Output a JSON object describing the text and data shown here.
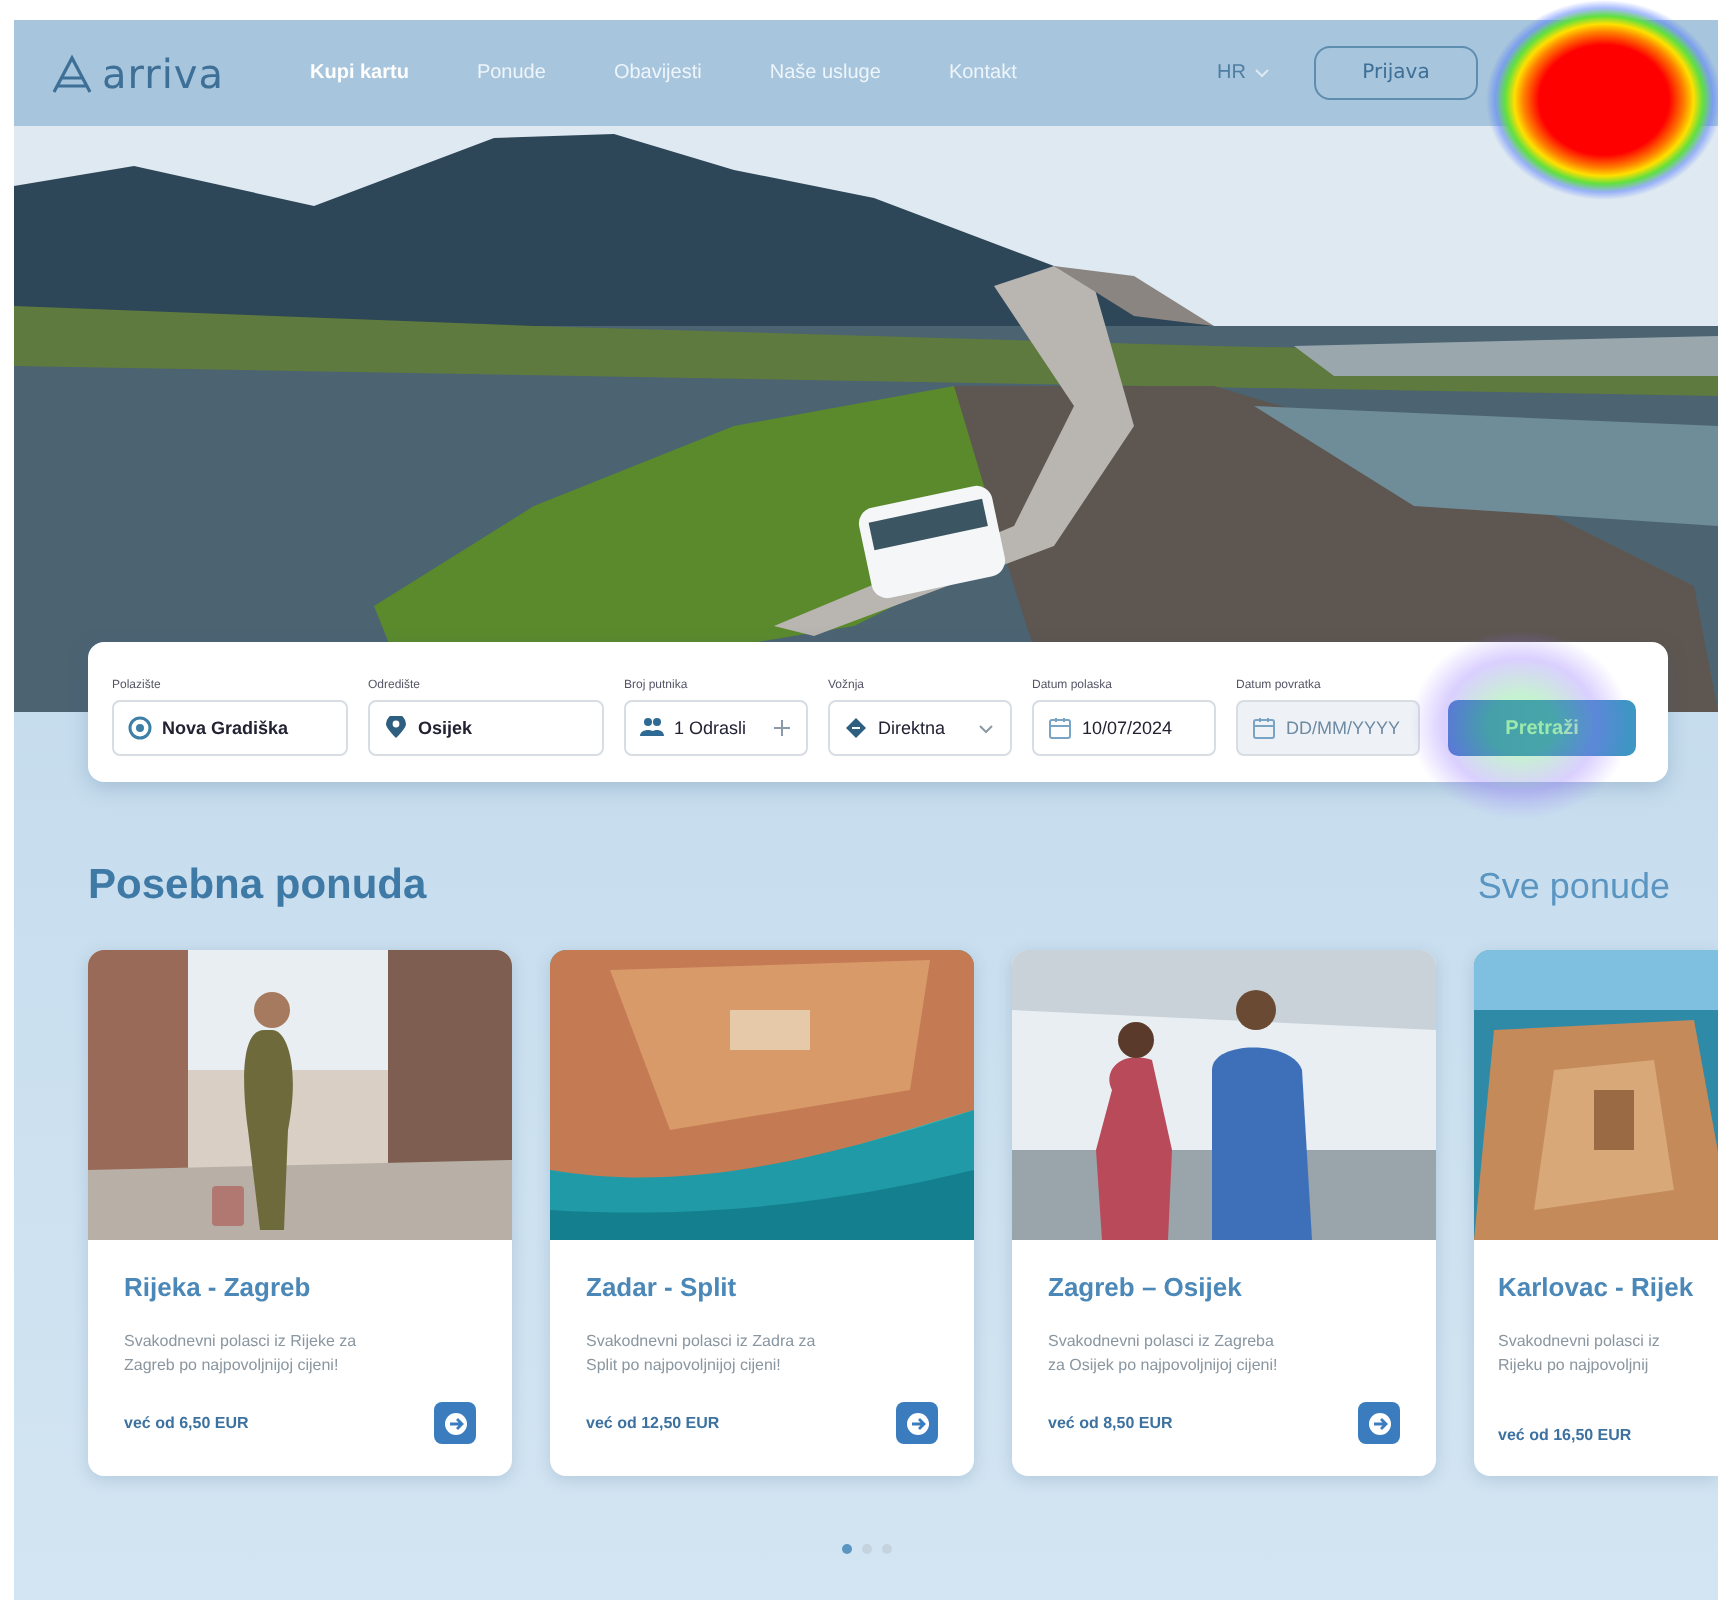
{
  "nav": {
    "logo": "arriva",
    "links": [
      {
        "label": "Kupi kartu",
        "selected": true
      },
      {
        "label": "Ponude",
        "selected": false
      },
      {
        "label": "Obavijesti",
        "selected": false
      },
      {
        "label": "Naše usluge",
        "selected": false
      },
      {
        "label": "Kontakt",
        "selected": false
      }
    ],
    "language": "HR",
    "login": "Prijava"
  },
  "search": {
    "fields": [
      {
        "kind": "origin",
        "label": "Polazište",
        "value": "Nova Gradiška"
      },
      {
        "kind": "destination",
        "label": "Odredište",
        "value": "Osijek"
      },
      {
        "kind": "passengers",
        "label": "Broj putnika",
        "value": "1 Odrasli"
      },
      {
        "kind": "trip",
        "label": "Vožnja",
        "value": "Direktna"
      },
      {
        "kind": "date",
        "label": "Datum polaska",
        "value": "10/07/2024"
      },
      {
        "kind": "date",
        "label": "Datum povratka",
        "placeholder": "DD/MM/YYYY"
      }
    ],
    "button": "Pretraži"
  },
  "offers": {
    "title": "Posebna ponuda",
    "all_link": "Sve ponude",
    "cards": [
      {
        "title": "Rijeka - Zagreb",
        "description": "Svakodnevni polasci iz Rijeke za\nZagreb po najpovoljnijoj cijeni!",
        "price": "već od 6,50 EUR",
        "cut": false
      },
      {
        "title": "Zadar - Split",
        "description": "Svakodnevni polasci iz Zadra za\nSplit po najpovoljnijoj cijeni!",
        "price": "već od 12,50 EUR",
        "cut": false
      },
      {
        "title": "Zagreb – Osijek",
        "description": "Svakodnevni polasci iz Zagreba\nza Osijek po najpovoljnijoj cijeni!",
        "price": "već od 8,50 EUR",
        "cut": false
      },
      {
        "title": "Karlovac - Rijek",
        "description": "Svakodnevni polasci iz\nRijeku po najpovoljnij",
        "price": "već od 16,50 EUR",
        "cut": true
      }
    ],
    "pages": [
      {
        "selected": true
      },
      {
        "selected": false
      },
      {
        "selected": false
      }
    ]
  }
}
